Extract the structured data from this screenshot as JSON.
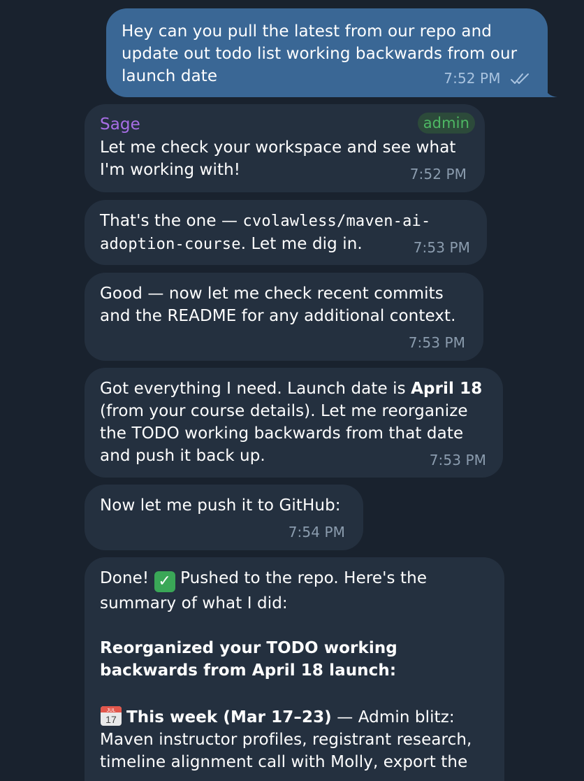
{
  "messages": {
    "m1": {
      "text": "Hey can you pull the latest from our repo and update out todo list working backwards from our launch date",
      "time": "7:52 PM",
      "read_status": "double-check-icon"
    },
    "m2": {
      "sender": "Sage",
      "badge": "admin",
      "text": "Let me check your workspace and see what I'm working with!",
      "time": "7:52 PM"
    },
    "m3": {
      "text_before": "That's the one — ",
      "code": "cvolawless/maven-ai-adoption-course",
      "text_after": ". Let me dig in.",
      "time": "7:53 PM"
    },
    "m4": {
      "text": "Good — now let me check recent commits and the README for any additional context.",
      "time": "7:53 PM"
    },
    "m5": {
      "text_before": "Got everything I need. Launch date is ",
      "bold": "April 18",
      "text_after": " (from your course details). Let me reorganize the TODO working backwards from that date and push it back up.",
      "time": "7:53 PM"
    },
    "m6": {
      "text": "Now let me push it to GitHub:",
      "time": "7:54 PM"
    },
    "m7": {
      "intro_1": "Done!",
      "emoji": "✓",
      "emoji_icon": "check-mark-emoji-icon",
      "intro_2": " Pushed to the repo. Here's the summary of what I did:",
      "heading": "Reorganized your TODO working backwards from April 18 launch:",
      "calendar_icon": "calendar-icon",
      "calendar_month": "JUL",
      "calendar_day": "17",
      "week_label": "This week (Mar 17–23)",
      "week_text": " — Admin blitz: Maven instructor profiles, registrant research, timeline alignment call with Molly, export the"
    }
  },
  "colors": {
    "background": "#19222e",
    "outgoing_bubble": "#3a6795",
    "incoming_bubble": "#24303f",
    "sender_name": "#a86ee6",
    "admin_badge": "#4eb864"
  }
}
